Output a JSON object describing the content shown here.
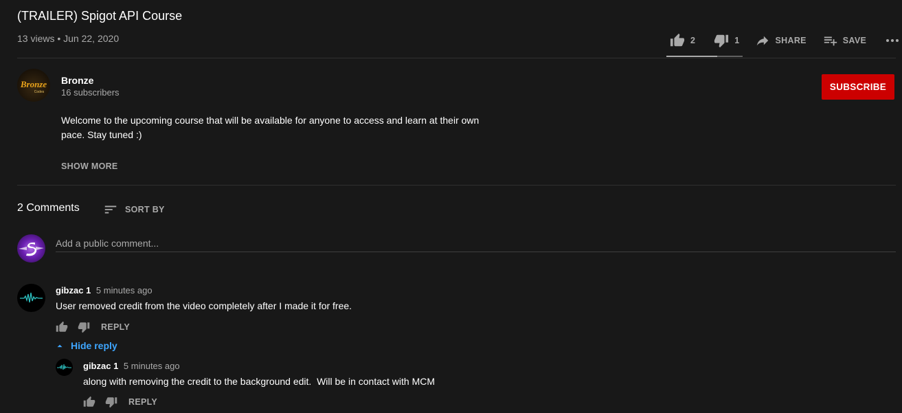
{
  "video": {
    "title": "(TRAILER) Spigot API Course",
    "meta": "13 views • Jun 22, 2020"
  },
  "actions": {
    "like_count": "2",
    "dislike_count": "1",
    "share_label": "SHARE",
    "save_label": "SAVE",
    "like_ratio": 0.667
  },
  "channel": {
    "name": "Bronze",
    "subscribers": "16 subscribers",
    "avatar_text": "Bronze",
    "avatar_subtext": "Codes",
    "subscribe_label": "SUBSCRIBE",
    "subscribe_color": "#cc0000"
  },
  "description": {
    "line1": "Welcome to the upcoming course that will be available for anyone to access and learn at their own",
    "line2": "pace. Stay tuned :)",
    "show_more_label": "SHOW MORE"
  },
  "comments": {
    "count_label": "2 Comments",
    "sort_label": "SORT BY",
    "input_placeholder": "Add a public comment...",
    "items": [
      {
        "author": "gibzac 1",
        "time": "5 minutes ago",
        "text": "User removed credit from the video completely after I made it for free.",
        "reply_label": "REPLY",
        "hide_reply_label": "Hide reply"
      }
    ],
    "replies": [
      {
        "author": "gibzac 1",
        "time": "5 minutes ago",
        "text": "along with removing the credit to the background edit.  Will be in contact with MCM",
        "reply_label": "REPLY"
      }
    ]
  },
  "colors": {
    "background": "#181818",
    "link_blue": "#3ea6ff",
    "muted_text": "#aaaaaa"
  },
  "icons": [
    "thumb-up-icon",
    "thumb-down-icon",
    "share-icon",
    "save-playlist-icon",
    "more-icon",
    "sort-icon",
    "chevron-up-icon"
  ]
}
